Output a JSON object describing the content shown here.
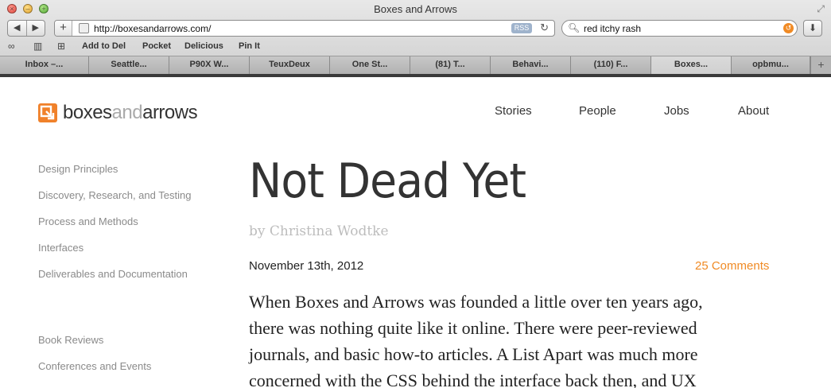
{
  "window": {
    "title": "Boxes and Arrows"
  },
  "toolbar": {
    "back": "◀",
    "forward": "▶",
    "add": "+",
    "url": "http://boxesandarrows.com/",
    "rss": "RSS",
    "search_value": "red itchy rash"
  },
  "bookmarks": [
    "Add to Del",
    "Pocket",
    "Delicious",
    "Pin It"
  ],
  "tabs": [
    "Inbox –...",
    "Seattle...",
    "P90X W...",
    "TeuxDeux",
    "One St...",
    "(81) T...",
    "Behavi...",
    "(110) F...",
    "Boxes...",
    "opbmu..."
  ],
  "site": {
    "logo_part1": "boxes",
    "logo_part2": "and",
    "logo_part3": "arrows",
    "nav": [
      "Stories",
      "People",
      "Jobs",
      "About"
    ],
    "sidebar": [
      "Design Principles",
      "Discovery, Research, and Testing",
      "Process and Methods",
      "Interfaces",
      "Deliverables and Documentation",
      "Book Reviews",
      "Conferences and Events"
    ]
  },
  "post": {
    "title": "Not Dead Yet",
    "byline": "by Christina Wodtke",
    "date": "November 13th, 2012",
    "comments": "25 Comments",
    "lines": [
      "When Boxes and Arrows was founded a little over ten years ago,",
      "there was nothing quite like it online. There were peer-reviewed",
      "journals, and basic how-to articles. A List Apart was much more",
      "concerned with the CSS behind the interface back then, and UX"
    ]
  }
}
